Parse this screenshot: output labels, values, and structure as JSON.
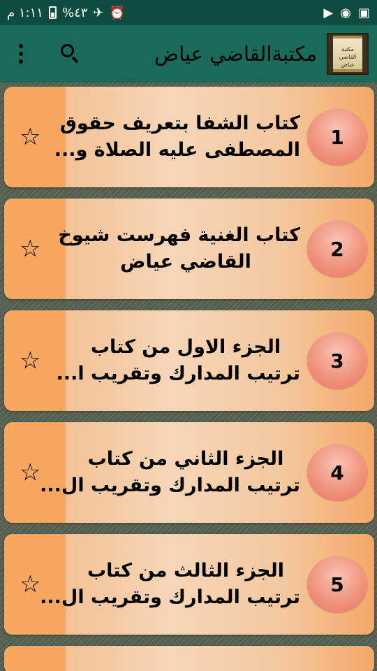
{
  "status_bar": {
    "time": "١:١١ م",
    "battery": "%٤٣"
  },
  "toolbar": {
    "title": "مكتبةالقاضي عياض",
    "logo_text": "مكتبة القاضي عياض"
  },
  "books": [
    {
      "number": "1",
      "line1": "كتاب الشفا بتعريف حقوق",
      "line2": "المصطفى عليه الصلاة و..."
    },
    {
      "number": "2",
      "line1": "كتاب الغنية فهرست شيوخ",
      "line2": "القاضي عياض"
    },
    {
      "number": "3",
      "line1": "الجزء الاول من كتاب",
      "line2": "ترتيب المدارك وتقريب ا..."
    },
    {
      "number": "4",
      "line1": "الجزء الثاني من كتاب",
      "line2": "ترتيب المدارك وتقريب ال..."
    },
    {
      "number": "5",
      "line1": "الجزء الثالث من كتاب",
      "line2": "ترتيب المدارك وتقريب ال..."
    }
  ],
  "colors": {
    "status_bar": "#0e4c40",
    "toolbar": "#1a6a5a",
    "card_accent": "#f8a761",
    "number_badge": "#f1907a"
  },
  "icons": {
    "favorite": "star-outline-icon",
    "search": "search-icon",
    "menu": "overflow-menu-icon"
  }
}
